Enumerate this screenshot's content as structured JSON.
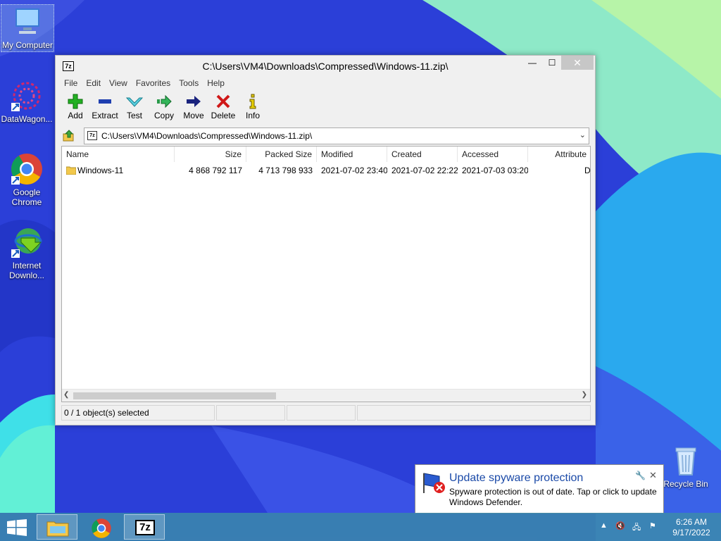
{
  "desktop": {
    "icons": [
      {
        "label": "My Computer"
      },
      {
        "label": "DataWagon..."
      },
      {
        "label": "Google Chrome"
      },
      {
        "label": "Internet Downlo..."
      },
      {
        "label": "Recycle Bin"
      }
    ]
  },
  "window": {
    "title": "C:\\Users\\VM4\\Downloads\\Compressed\\Windows-11.zip\\",
    "app_icon": "7z",
    "controls": {
      "minimize": "—",
      "maximize": "☐",
      "close": "✕"
    },
    "menu": [
      "File",
      "Edit",
      "View",
      "Favorites",
      "Tools",
      "Help"
    ],
    "toolbar": [
      {
        "label": "Add",
        "icon": "plus-icon",
        "color": "#1fa51f"
      },
      {
        "label": "Extract",
        "icon": "minus-icon",
        "color": "#1f3fb0"
      },
      {
        "label": "Test",
        "icon": "check-down-icon",
        "color": "#3fb0c0"
      },
      {
        "label": "Copy",
        "icon": "copy-arrow-icon",
        "color": "#2a9a4a"
      },
      {
        "label": "Move",
        "icon": "move-arrow-icon",
        "color": "#1a237e"
      },
      {
        "label": "Delete",
        "icon": "x-icon",
        "color": "#d01818"
      },
      {
        "label": "Info",
        "icon": "info-icon",
        "color": "#c8b400"
      }
    ],
    "address": "C:\\Users\\VM4\\Downloads\\Compressed\\Windows-11.zip\\",
    "columns": [
      "Name",
      "Size",
      "Packed Size",
      "Modified",
      "Created",
      "Accessed",
      "Attribute"
    ],
    "rows": [
      {
        "name": "Windows-11",
        "size": "4 868 792 117",
        "packed": "4 713 798 933",
        "modified": "2021-07-02 23:40",
        "created": "2021-07-02 22:22",
        "accessed": "2021-07-03 03:20",
        "attr": "D"
      }
    ],
    "status": "0 / 1 object(s) selected"
  },
  "notification": {
    "title": "Update spyware protection",
    "message": "Spyware protection is out of date. Tap or click to update Windows Defender."
  },
  "taskbar": {
    "time": "6:26 AM",
    "date": "9/17/2022",
    "apps": [
      "file-explorer-icon",
      "chrome-icon",
      "7zip-icon"
    ],
    "sevenzip_label": "7z"
  }
}
